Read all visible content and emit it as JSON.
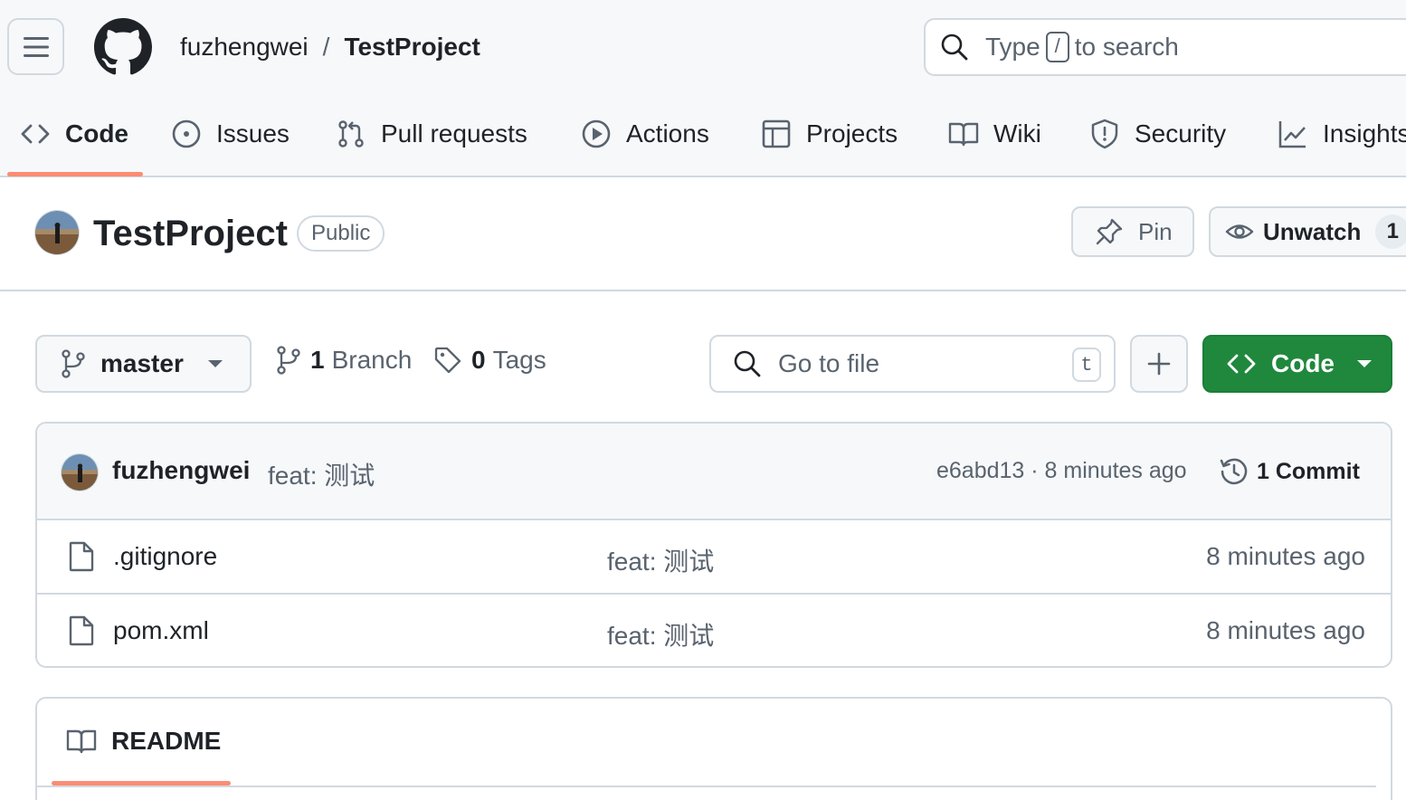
{
  "header": {
    "owner": "fuzhengwei",
    "separator": "/",
    "repo": "TestProject",
    "search": {
      "prefix": "Type",
      "key": "/",
      "suffix": "to search"
    }
  },
  "nav": {
    "tabs": [
      {
        "label": "Code",
        "icon": "code-icon",
        "active": true
      },
      {
        "label": "Issues",
        "icon": "issue-opened-icon"
      },
      {
        "label": "Pull requests",
        "icon": "git-pull-request-icon"
      },
      {
        "label": "Actions",
        "icon": "play-icon"
      },
      {
        "label": "Projects",
        "icon": "table-icon"
      },
      {
        "label": "Wiki",
        "icon": "book-icon"
      },
      {
        "label": "Security",
        "icon": "shield-icon"
      },
      {
        "label": "Insights",
        "icon": "graph-icon"
      }
    ]
  },
  "repo_header": {
    "title": "TestProject",
    "visibility": "Public",
    "pin_label": "Pin",
    "watch_label": "Unwatch",
    "watch_count": "1"
  },
  "toolbar": {
    "branch": "master",
    "branch_count": "1",
    "branch_label": "Branch",
    "tag_count": "0",
    "tag_label": "Tags",
    "goto_placeholder": "Go to file",
    "goto_shortcut": "t",
    "code_label": "Code"
  },
  "latest_commit": {
    "author": "fuzhengwei",
    "message": "feat: 测试",
    "meta": "e6abd13 · 8 minutes ago",
    "count_label": "1 Commit"
  },
  "files": [
    {
      "name": ".gitignore",
      "message": "feat: 测试",
      "age": "8 minutes ago"
    },
    {
      "name": "pom.xml",
      "message": "feat: 测试",
      "age": "8 minutes ago"
    }
  ],
  "readme": {
    "tab_label": "README"
  },
  "colors": {
    "accent_underline": "#fd8c73",
    "primary_button": "#1f883d",
    "muted_text": "#59636e",
    "border": "#d1d9e0"
  }
}
